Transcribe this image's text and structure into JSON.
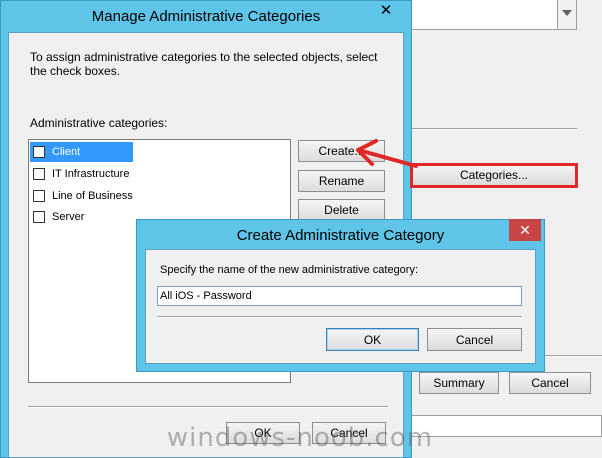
{
  "main_dialog": {
    "title": "Manage Administrative Categories",
    "close_glyph": "✕",
    "instructions": "To assign administrative categories to the selected objects, select the check boxes.",
    "list_label": "Administrative categories:",
    "categories": [
      {
        "label": "Client",
        "checked": false,
        "selected": true
      },
      {
        "label": "IT Infrastructure",
        "checked": false,
        "selected": false
      },
      {
        "label": "Line of Business",
        "checked": false,
        "selected": false
      },
      {
        "label": "Server",
        "checked": false,
        "selected": false
      }
    ],
    "buttons": {
      "create": "Create...",
      "rename": "Rename",
      "delete": "Delete",
      "ok": "OK",
      "cancel": "Cancel"
    }
  },
  "create_dialog": {
    "title": "Create Administrative Category",
    "close_glyph": "✕",
    "prompt": "Specify the name of the new administrative category:",
    "name_value": "All iOS - Password",
    "buttons": {
      "ok": "OK",
      "cancel": "Cancel"
    }
  },
  "background_window": {
    "categories_button": "Categories...",
    "summary_button": "Summary",
    "cancel_button": "Cancel"
  },
  "watermark": "windows-noob.com",
  "colors": {
    "title_bar": "#5ec5e8",
    "selection": "#3399ff",
    "annotation_red": "#e02828",
    "close_red": "#c74545"
  }
}
